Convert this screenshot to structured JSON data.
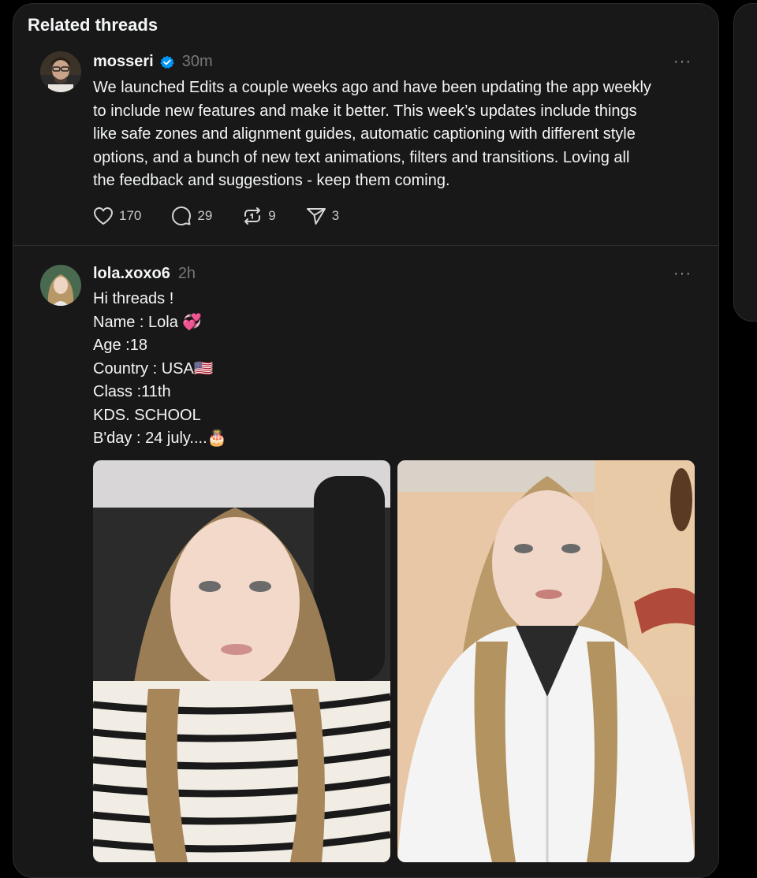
{
  "section": {
    "title": "Related threads"
  },
  "posts": [
    {
      "username": "mosseri",
      "verified": true,
      "time": "30m",
      "more_label": "···",
      "lines": [
        "We launched Edits a couple weeks ago and have been updating the app weekly",
        "to include new features and make it better. This week’s updates include things",
        "like safe zones and alignment guides, automatic captioning with different style",
        "options, and a bunch of new text animations, filters and transitions. Loving all",
        "the feedback and suggestions - keep them coming."
      ],
      "likes": "170",
      "replies": "29",
      "reposts": "9",
      "shares": "3"
    },
    {
      "username": "lola.xoxo6",
      "verified": false,
      "time": "2h",
      "more_label": "···",
      "lines": [
        "Hi threads !",
        "Name : Lola 💞",
        "Age :18",
        "Country : USA🇺🇸",
        "Class :11th",
        "KDS. SCHOOL",
        "B'day : 24 july....🎂"
      ]
    }
  ],
  "colors": {
    "background": "#000000",
    "panel": "#181818",
    "border": "#2d2d2d",
    "text": "#f3f5f7",
    "muted": "#777777",
    "verified": "#0095f6"
  },
  "icons": [
    "verified-badge-icon",
    "more-icon",
    "heart-icon",
    "comment-icon",
    "repost-icon",
    "share-icon"
  ]
}
